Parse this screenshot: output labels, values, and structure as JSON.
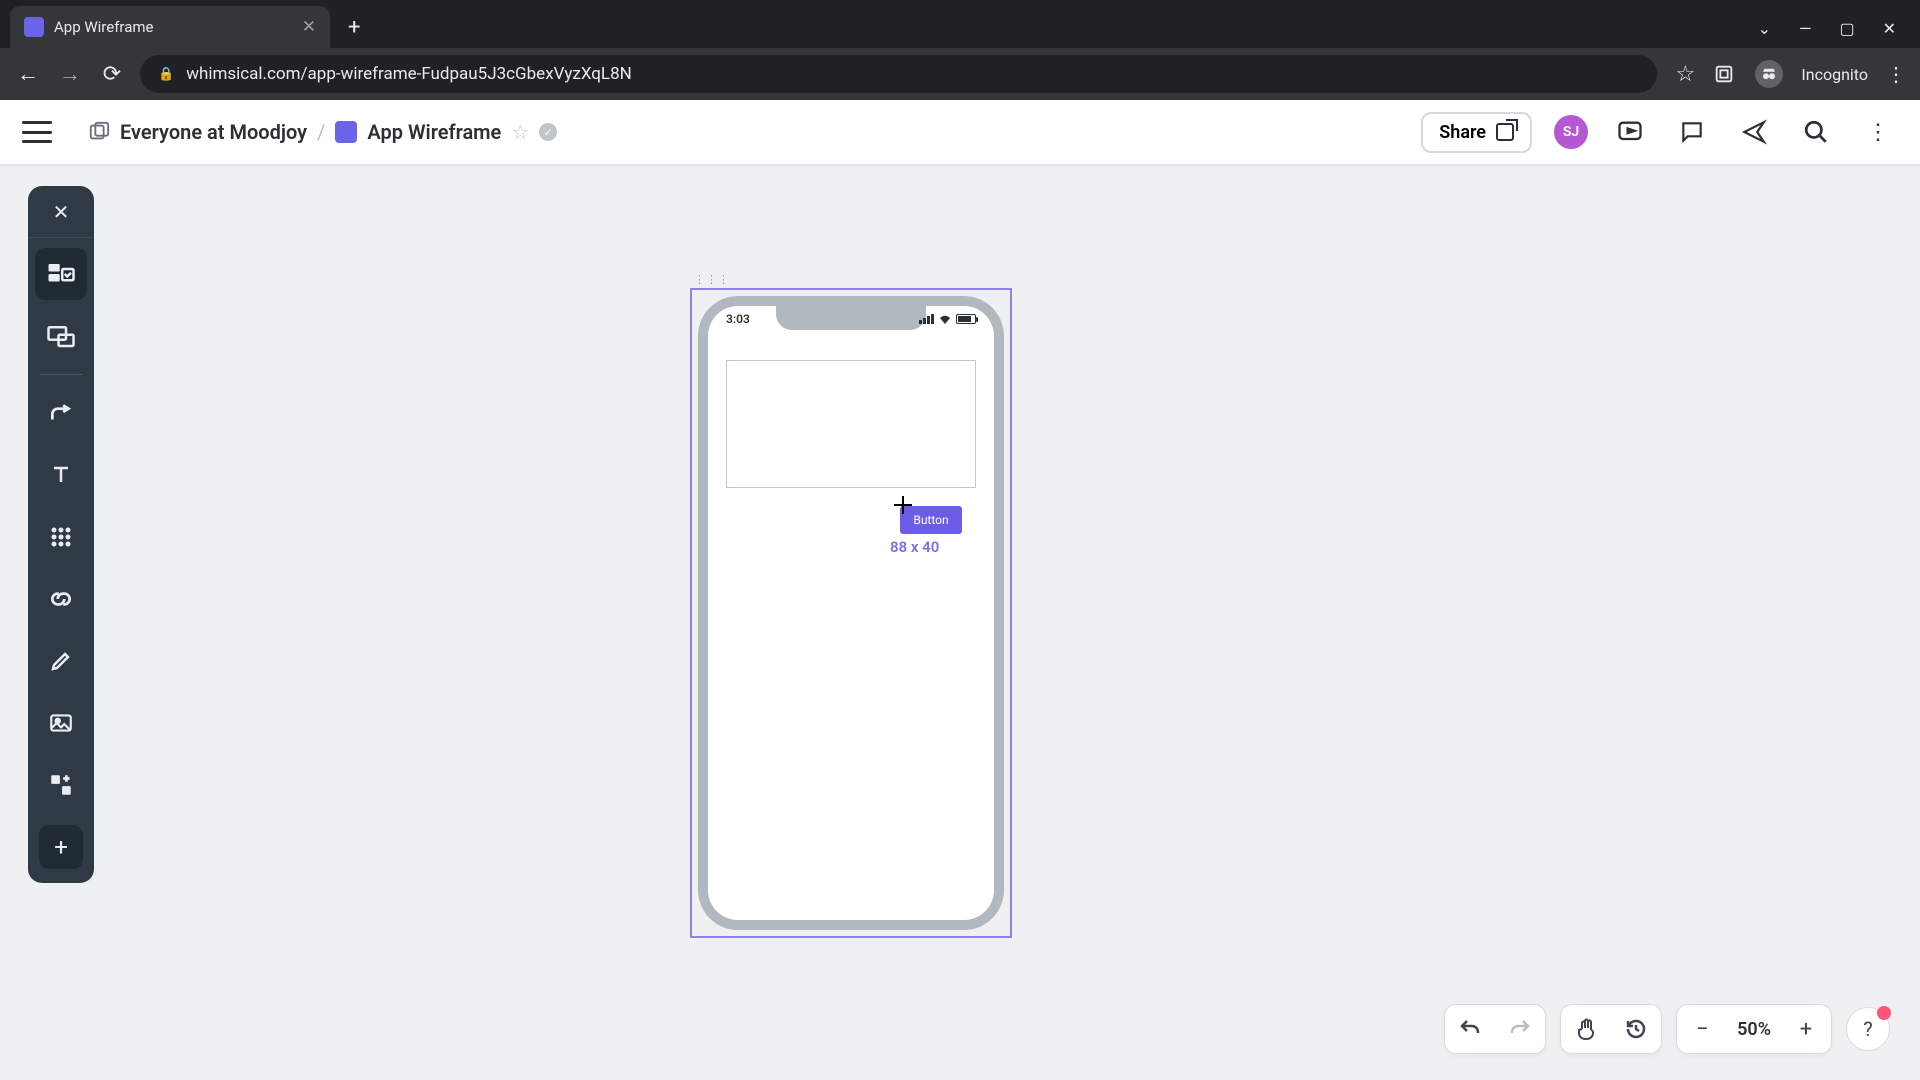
{
  "browser": {
    "tab_title": "App Wireframe",
    "url": "whimsical.com/app-wireframe-Fudpau5J3cGbexVyzXqL8N",
    "incognito_label": "Incognito"
  },
  "header": {
    "workspace": "Everyone at Moodjoy",
    "doc_title": "App Wireframe",
    "share_label": "Share",
    "avatar_initials": "SJ"
  },
  "canvas": {
    "phone_time": "3:03",
    "button_label": "Button",
    "size_label": "88 x 40"
  },
  "bottom": {
    "zoom": "50%"
  }
}
